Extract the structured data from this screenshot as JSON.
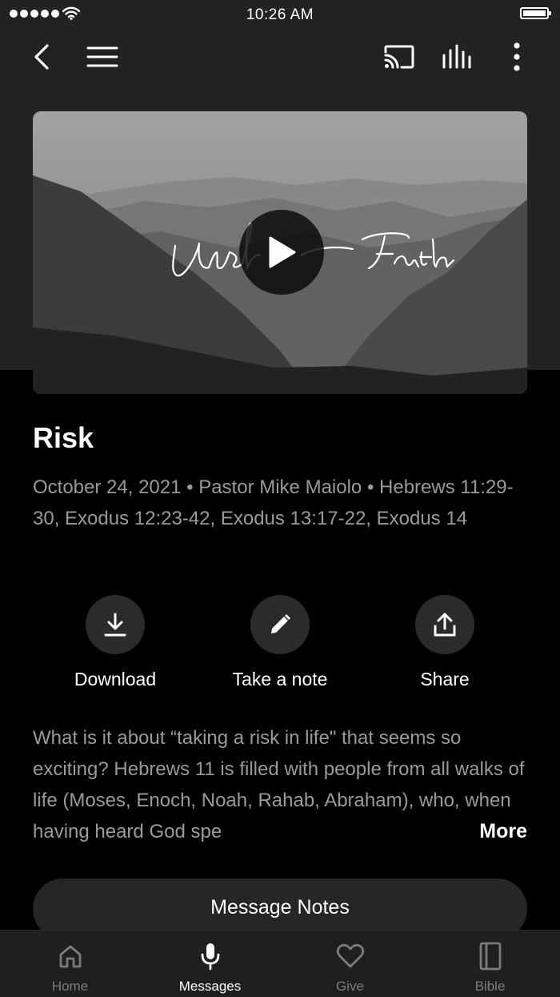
{
  "status_bar": {
    "time": "10:26 AM"
  },
  "nav": {
    "icons": [
      "back-icon",
      "menu-icon",
      "cast-icon",
      "audio-bars-icon",
      "more-vertical-icon"
    ]
  },
  "video": {
    "overlay_title": "Unshakable Faith"
  },
  "message": {
    "title": "Risk",
    "meta": "October 24, 2021 • Pastor Mike Maiolo • Hebrews 11:29-30, Exodus 12:23-42, Exodus 13:17-22, Exodus 14",
    "description": "What is it about “taking a risk in life\" that seems so exciting? Hebrews 11 is filled with people from all walks of life (Moses, Enoch, Noah, Rahab, Abraham), who, when having heard God spe",
    "more_label": "More"
  },
  "actions": [
    {
      "label": "Download",
      "icon": "download-icon"
    },
    {
      "label": "Take a note",
      "icon": "pencil-icon"
    },
    {
      "label": "Share",
      "icon": "share-icon"
    }
  ],
  "notes_button": {
    "label": "Message Notes"
  },
  "tabbar": {
    "active": "Messages",
    "tabs": [
      {
        "label": "Home",
        "icon": "home-icon"
      },
      {
        "label": "Messages",
        "icon": "microphone-icon"
      },
      {
        "label": "Give",
        "icon": "heart-icon"
      },
      {
        "label": "Bible",
        "icon": "book-icon"
      }
    ]
  },
  "colors": {
    "background": "#000000",
    "header_bg": "#202224",
    "muted_text": "#9a9a9a",
    "button_bg": "#2b2b2b",
    "tab_inactive": "#7b7b7b"
  }
}
